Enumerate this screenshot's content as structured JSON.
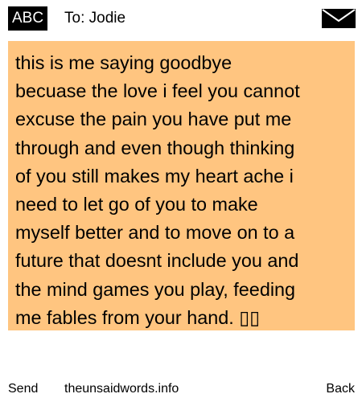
{
  "header": {
    "input_mode": "ABC",
    "recipient": "To: Jodie",
    "message_icon": "envelope-icon"
  },
  "message": {
    "text": "this is me saying goodbye\nbecuase the love i feel you cannot\nexcuse the pain you have put me\nthrough and even though thinking\nof you still makes my heart ache i\nneed to let go of you to make\nmyself better and to move on to a\nfuture that doesnt include you and\nthe mind games you play, feeding\nme fables from your hand. ▯▯",
    "background_color": "#ffc580"
  },
  "footer": {
    "send_label": "Send",
    "site": "theunsaidwords.info",
    "back_label": "Back"
  }
}
